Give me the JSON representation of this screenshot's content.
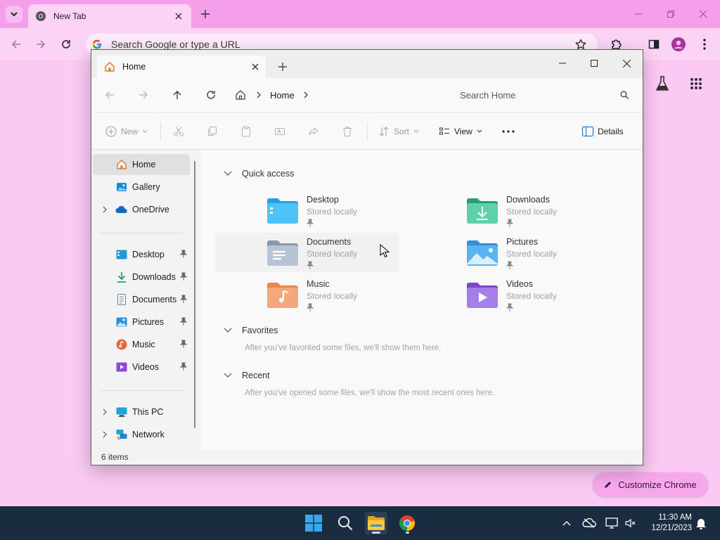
{
  "chrome": {
    "tab_title": "New Tab",
    "omnibox_placeholder": "Search Google or type a URL",
    "customize_label": "Customize Chrome"
  },
  "explorer": {
    "tab_title": "Home",
    "breadcrumb": "Home",
    "search_placeholder": "Search Home",
    "commands": {
      "new": "New",
      "sort": "Sort",
      "view": "View",
      "details": "Details"
    },
    "sidebar": {
      "home": "Home",
      "gallery": "Gallery",
      "onedrive": "OneDrive",
      "desktop": "Desktop",
      "downloads": "Downloads",
      "documents": "Documents",
      "pictures": "Pictures",
      "music": "Music",
      "videos": "Videos",
      "this_pc": "This PC",
      "network": "Network"
    },
    "quick_access": {
      "header": "Quick access",
      "items": [
        {
          "name": "Desktop",
          "sub": "Stored locally"
        },
        {
          "name": "Downloads",
          "sub": "Stored locally"
        },
        {
          "name": "Documents",
          "sub": "Stored locally"
        },
        {
          "name": "Pictures",
          "sub": "Stored locally"
        },
        {
          "name": "Music",
          "sub": "Stored locally"
        },
        {
          "name": "Videos",
          "sub": "Stored locally"
        }
      ]
    },
    "favorites": {
      "header": "Favorites",
      "message": "After you've favorited some files, we'll show them here."
    },
    "recent": {
      "header": "Recent",
      "message": "After you've opened some files, we'll show the most recent ones here."
    },
    "status": "6 items"
  },
  "taskbar": {
    "time": "11:30 AM",
    "date": "12/21/2023"
  },
  "colors": {
    "chrome_frame": "#f59ee9",
    "chrome_toolbar": "#fbd3f5",
    "page_background": "#fbc9f3",
    "taskbar": "#1a2d40",
    "accent": "#0078d4"
  }
}
